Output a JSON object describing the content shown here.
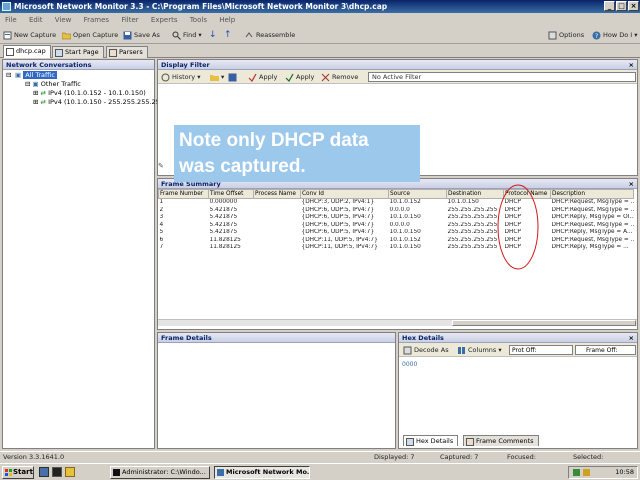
{
  "window": {
    "title": "Microsoft Network Monitor 3.3 - C:\\Program Files\\Microsoft Network Monitor 3\\dhcp.cap",
    "minimize": "_",
    "maximize": "□",
    "close": "×"
  },
  "menu": [
    "File",
    "Edit",
    "View",
    "Frames",
    "Filter",
    "Experts",
    "Tools",
    "Help"
  ],
  "toolbar": {
    "new_capture": "New Capture",
    "open_capture": "Open Capture",
    "save_as": "Save As",
    "find": "Find",
    "reassemble": "Reassemble",
    "options": "Options",
    "how_do_i": "How Do I"
  },
  "tabs": [
    "dhcp.cap",
    "Start Page",
    "Parsers"
  ],
  "network_conversations": {
    "title": "Network Conversations",
    "all_traffic": "All Traffic",
    "other_traffic": "Other Traffic",
    "items": [
      "IPv4 (10.1.0.152 - 10.1.0.150)",
      "IPv4 (10.1.0.150 - 255.255.255.255)"
    ]
  },
  "display_filter": {
    "title": "Display Filter",
    "history": "History",
    "apply": "Apply",
    "apply2": "Apply",
    "remove": "Remove",
    "status": "No Active Filter"
  },
  "note": {
    "line1": "Note only DHCP data",
    "line2": "was captured."
  },
  "frame_summary": {
    "title": "Frame Summary",
    "columns": [
      "Frame Number",
      "Time Offset",
      "Process Name",
      "Conv Id",
      "Source",
      "Destination",
      "Protocol Name",
      "Description"
    ],
    "rows": [
      [
        "1",
        "0.000000",
        "",
        "{DHCP:3, UDP:2, IPv4:1}",
        "10.1.0.152",
        "10.1.0.150",
        "DHCP",
        "DHCP:Request, MsgType = ..."
      ],
      [
        "2",
        "5.421875",
        "",
        "{DHCP:6, UDP:5, IPv4:7}",
        "0.0.0.0",
        "255.255.255.255",
        "DHCP",
        "DHCP:Request, MsgType = ..."
      ],
      [
        "3",
        "5.421875",
        "",
        "{DHCP:6, UDP:5, IPv4:7}",
        "10.1.0.150",
        "255.255.255.255",
        "DHCP",
        "DHCP:Reply, MsgType = OI..."
      ],
      [
        "4",
        "5.421875",
        "",
        "{DHCP:6, UDP:5, IPv4:7}",
        "0.0.0.0",
        "255.255.255.255",
        "DHCP",
        "DHCP:Request, MsgType = ..."
      ],
      [
        "5",
        "5.421875",
        "",
        "{DHCP:6, UDP:5, IPv4:7}",
        "10.1.0.150",
        "255.255.255.255",
        "DHCP",
        "DHCP:Reply, MsgType = A..."
      ],
      [
        "6",
        "11.828125",
        "",
        "{DHCP:11, UDP:5, IPv4:7}",
        "10.1.0.152",
        "255.255.255.255",
        "DHCP",
        "DHCP:Request, MsgType = ..."
      ],
      [
        "7",
        "11.828125",
        "",
        "{DHCP:11, UDP:5, IPv4:7}",
        "10.1.0.150",
        "255.255.255.255",
        "DHCP",
        "DHCP:Reply, MsgType = ..."
      ]
    ]
  },
  "frame_details": {
    "title": "Frame Details"
  },
  "hex_details": {
    "title": "Hex Details",
    "decode_as": "Decode As",
    "columns": "Columns",
    "prot_off": "Prot Off:",
    "frame_off": "Frame Off:",
    "offset": "0000",
    "tab_hex": "Hex Details",
    "tab_comments": "Frame Comments"
  },
  "status": {
    "version": "Version 3.3.1641.0",
    "displayed": "Displayed: 7",
    "captured": "Captured: 7",
    "focused": "Focused:",
    "selected": "Selected:"
  },
  "taskbar": {
    "start": "Start",
    "items": [
      "Administrator: C:\\Windo...",
      "Microsoft Network Mo..."
    ],
    "clock": "10:58"
  },
  "colors": {
    "title_bar": "#0a246a",
    "panel_header": "#c8d0e4",
    "note_box": "#9cc8ec",
    "highlight_circle": "#d01818"
  }
}
